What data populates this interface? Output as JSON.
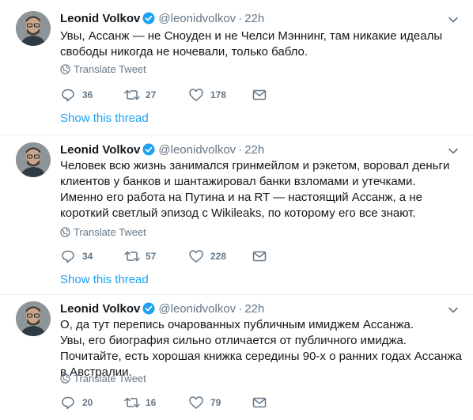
{
  "colors": {
    "link": "#1da1f2",
    "muted": "#657786",
    "verified": "#1da1f2",
    "text": "#14171a"
  },
  "icons": [
    "avatar",
    "verified-badge-icon",
    "chevron-down-icon",
    "globe-icon",
    "reply-icon",
    "retweet-icon",
    "like-icon",
    "direct-message-icon"
  ],
  "tweets": [
    {
      "name": "Leonid Volkov",
      "handle": "@leonidvolkov",
      "dot": "·",
      "time": "22h",
      "lines": [
        "Увы, Ассанж — не Сноуден и не Челси Мэннинг, там никакие идеалы свободы никогда не ночевали, только бабло."
      ],
      "translate": "Translate Tweet",
      "replies": "36",
      "retweets": "27",
      "likes": "178",
      "show_thread": "Show this thread"
    },
    {
      "name": "Leonid Volkov",
      "handle": "@leonidvolkov",
      "dot": "·",
      "time": "22h",
      "lines": [
        "Человек всю жизнь занимался гринмейлом и рэкетом, воровал деньги клиентов у банков и шантажировал банки взломами и утечками.",
        "Именно его работа на Путина и на RT — настоящий Ассанж, а не короткий светлый эпизод с Wikileaks, по которому его все знают."
      ],
      "translate": "Translate Tweet",
      "replies": "34",
      "retweets": "57",
      "likes": "228",
      "show_thread": "Show this thread"
    },
    {
      "name": "Leonid Volkov",
      "handle": "@leonidvolkov",
      "dot": "·",
      "time": "22h",
      "lines": [
        "О, да тут перепись очарованных публичным имиджем Ассанжа.",
        "Увы, его биография сильно отличается от публичного имиджа. Почитайте, есть хорошая книжка середины 90-х о ранних годах Ассанжа в Австралии."
      ],
      "translate": "Translate Tweet",
      "replies": "20",
      "retweets": "16",
      "likes": "79"
    }
  ]
}
